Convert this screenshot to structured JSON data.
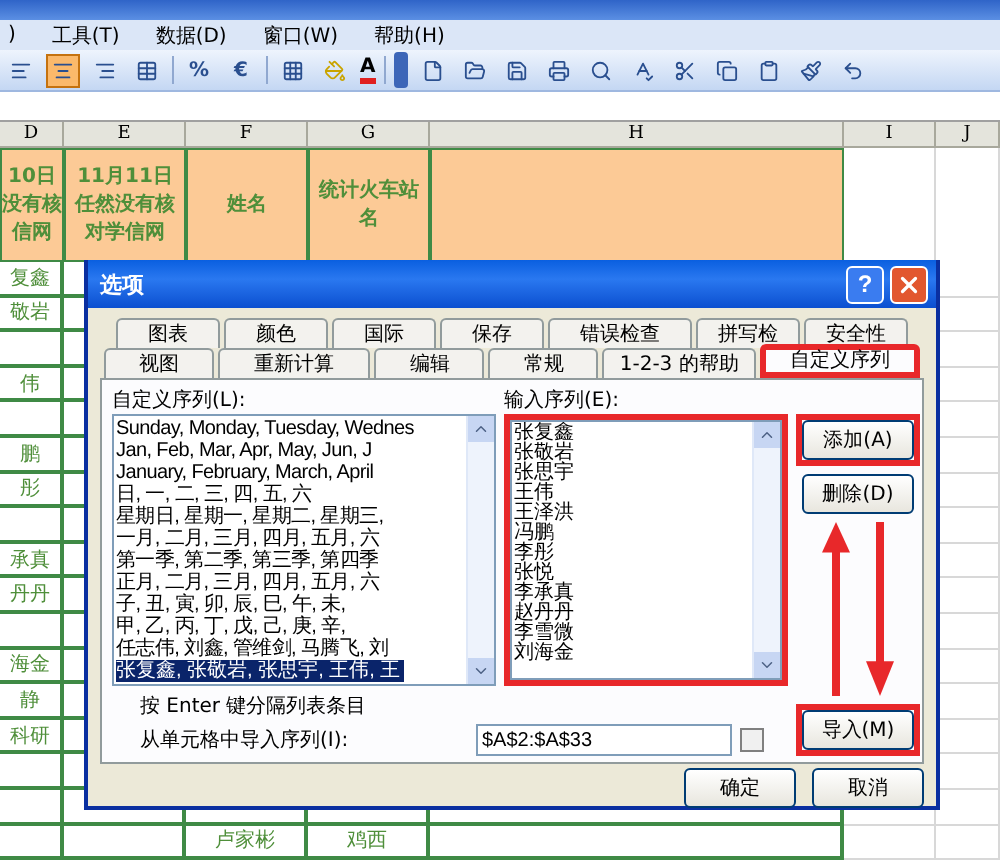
{
  "menu": [
    ")",
    "工具(T)",
    "数据(D)",
    "窗口(W)",
    "帮助(H)"
  ],
  "toolbar": {
    "alignment": [
      {
        "selected": false
      },
      {
        "selected": true
      },
      {
        "selected": false
      },
      {
        "selected": false
      }
    ],
    "glyphs": [
      "%",
      "€"
    ],
    "font_color_label": "A"
  },
  "sheet": {
    "columns": [
      "D",
      "E",
      "F",
      "G",
      "H",
      "I",
      "J"
    ],
    "header_row": [
      [
        "10日",
        "没有核",
        "信网"
      ],
      [
        "11月11日",
        "任然没有核",
        "对学信网"
      ],
      [
        "姓名"
      ],
      [
        "统计火车站",
        "名"
      ]
    ],
    "rows": [
      {
        "column_d": "复鑫"
      },
      {
        "column_d": "敬岩"
      },
      {},
      {
        "column_d": "伟"
      },
      {},
      {
        "column_d": "鹏"
      },
      {
        "column_d": "彤"
      },
      {},
      {
        "column_d": "承真"
      },
      {
        "column_d": "丹丹"
      },
      {},
      {
        "column_d": "海金"
      },
      {
        "column_d": "静"
      },
      {
        "column_d": "科研"
      },
      {},
      {},
      {
        "column_f": "卢家彬",
        "column_g": "鸡西"
      }
    ]
  },
  "dialog": {
    "title": "选项",
    "help_button": "?",
    "tab_rows": [
      [
        {
          "label": "图表",
          "selected": false
        },
        {
          "label": "颜色",
          "selected": false
        },
        {
          "label": "国际",
          "selected": false
        },
        {
          "label": "保存",
          "selected": false
        },
        {
          "label": "错误检查",
          "selected": false
        },
        {
          "label": "拼写检",
          "selected": false
        },
        {
          "label": "安全性",
          "selected": false
        }
      ],
      [
        {
          "label": "视图",
          "selected": false
        },
        {
          "label": "重新计算",
          "selected": false
        },
        {
          "label": "编辑",
          "selected": false
        },
        {
          "label": "常规",
          "selected": false
        },
        {
          "label": "1-2-3 的帮助",
          "selected": false
        },
        {
          "label": "自定义序列",
          "selected": true
        }
      ]
    ],
    "custom_lists_label": "自定义序列(L):",
    "custom_lists": [
      {
        "text": "Sunday, Monday, Tuesday, Wednes",
        "selected": false
      },
      {
        "text": "Jan, Feb, Mar, Apr, May, Jun, J",
        "selected": false
      },
      {
        "text": "January, February, March, April",
        "selected": false
      },
      {
        "text": "日, 一, 二, 三, 四, 五, 六",
        "selected": false
      },
      {
        "text": "星期日, 星期一, 星期二, 星期三,",
        "selected": false
      },
      {
        "text": "一月, 二月, 三月, 四月, 五月, 六",
        "selected": false
      },
      {
        "text": "第一季, 第二季, 第三季, 第四季",
        "selected": false
      },
      {
        "text": "正月, 二月, 三月, 四月, 五月, 六",
        "selected": false
      },
      {
        "text": "子, 丑, 寅, 卯, 辰, 巳, 午, 未,",
        "selected": false
      },
      {
        "text": "甲, 乙, 丙, 丁, 戊, 己, 庚, 辛,",
        "selected": false
      },
      {
        "text": "任志伟, 刘鑫, 管维剑, 马腾飞, 刘",
        "selected": false
      },
      {
        "text": "张复鑫, 张敬岩, 张思宇, 王伟, 王",
        "selected": true
      }
    ],
    "entries_label": "输入序列(E):",
    "entries": [
      "张复鑫",
      "张敬岩",
      "张思宇",
      "王伟",
      "王泽洪",
      "冯鹏",
      "李彤",
      "张悦",
      "李承真",
      "赵丹丹",
      "李雪微",
      "刘海金"
    ],
    "add_button": "添加(A)",
    "delete_button": "删除(D)",
    "hint": "按 Enter 键分隔列表条目",
    "import_label": "从单元格中导入序列(I):",
    "import_range": "$A$2:$A$33",
    "import_button": "导入(M)",
    "ok_button": "确定",
    "cancel_button": "取消"
  }
}
